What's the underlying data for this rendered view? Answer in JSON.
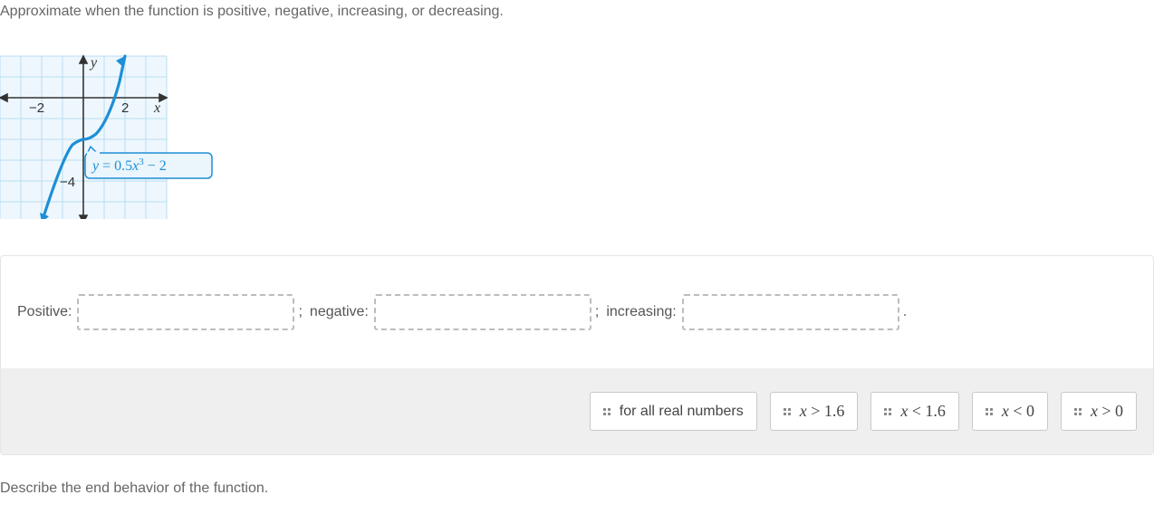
{
  "question": "Approximate when the function is positive, negative, increasing, or decreasing.",
  "graph": {
    "y_axis_label": "y",
    "x_axis_label": "x",
    "tick_neg2": "−2",
    "tick_2": "2",
    "tick_neg4": "−4",
    "equation_label": "y = 0.5x³ − 2"
  },
  "drops": {
    "positive_label": "Positive:",
    "negative_label": "negative:",
    "increasing_label": "increasing:",
    "semicolon": ";",
    "period": "."
  },
  "tiles": {
    "all_real": "for all real numbers",
    "x_gt_1_6_pre": "x",
    "x_gt_1_6_op": ">",
    "x_gt_1_6_val": "1.6",
    "x_lt_1_6_pre": "x",
    "x_lt_1_6_op": "<",
    "x_lt_1_6_val": "1.6",
    "x_lt_0_pre": "x",
    "x_lt_0_op": "<",
    "x_lt_0_val": "0",
    "x_gt_0_pre": "x",
    "x_gt_0_op": ">",
    "x_gt_0_val": "0"
  },
  "end_behavior": "Describe the end behavior of the function.",
  "chart_data": {
    "type": "line",
    "title": "",
    "xlabel": "x",
    "ylabel": "y",
    "xlim": [
      -4,
      4
    ],
    "ylim": [
      -6,
      2
    ],
    "x_ticks": [
      -2,
      2
    ],
    "y_ticks": [
      -4
    ],
    "equation": "y = 0.5x^3 - 2",
    "series": [
      {
        "name": "y = 0.5x^3 - 2",
        "x": [
          -2,
          -1.5,
          -1,
          -0.5,
          0,
          0.5,
          1,
          1.5,
          1.6,
          2
        ],
        "y": [
          -6,
          -3.69,
          -2.5,
          -2.06,
          -2,
          -1.94,
          -1.5,
          -0.31,
          0.05,
          2
        ]
      }
    ],
    "annotations": [
      {
        "text": "y = 0.5x³ − 2",
        "x": 2.5,
        "y": -2.6
      }
    ]
  }
}
